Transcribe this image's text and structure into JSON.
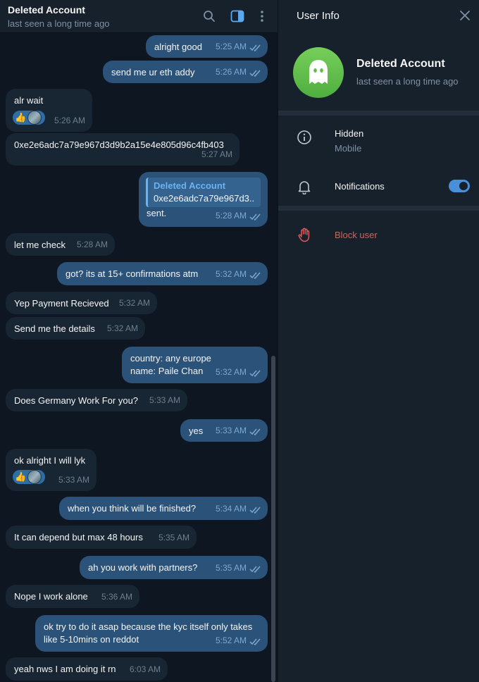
{
  "chat": {
    "title": "Deleted Account",
    "status": "last seen a long time ago",
    "messages": [
      {
        "dir": "out",
        "text": "alright good",
        "time": "5:25 AM"
      },
      {
        "dir": "out",
        "text": "send me ur eth addy",
        "time": "5:26 AM"
      },
      {
        "dir": "in",
        "text": "alr wait",
        "time": "5:26 AM",
        "reaction": "👍"
      },
      {
        "dir": "in",
        "text": "0xe2e6adc7a79e967d3d9b2a15e4e805d96c4fb403",
        "time": "5:27 AM"
      },
      {
        "dir": "out",
        "reply_name": "Deleted Account",
        "reply_text": "0xe2e6adc7a79e967d3...",
        "text": "sent.",
        "time": "5:28 AM"
      },
      {
        "dir": "in",
        "text": "let me check",
        "time": "5:28 AM"
      },
      {
        "dir": "out",
        "text": "got? its at 15+ confirmations atm",
        "time": "5:32 AM"
      },
      {
        "dir": "in",
        "text": "Yep Payment Recieved",
        "time": "5:32 AM"
      },
      {
        "dir": "in",
        "text": "Send me the details",
        "time": "5:32 AM"
      },
      {
        "dir": "out",
        "text": "country: any europe",
        "text2": "name: Paile Chan",
        "time": "5:32 AM"
      },
      {
        "dir": "in",
        "text": "Does Germany Work For you?",
        "time": "5:33 AM"
      },
      {
        "dir": "out",
        "text": "yes",
        "time": "5:33 AM"
      },
      {
        "dir": "in",
        "text": "ok alright I will lyk",
        "time": "5:33 AM",
        "reaction": "👍"
      },
      {
        "dir": "out",
        "text": "when you think will be finished?",
        "time": "5:34 AM"
      },
      {
        "dir": "in",
        "text": "It can depend but max 48 hours",
        "time": "5:35 AM"
      },
      {
        "dir": "out",
        "text": "ah you work with partners?",
        "time": "5:35 AM"
      },
      {
        "dir": "in",
        "text": "Nope I work alone",
        "time": "5:36 AM"
      },
      {
        "dir": "out",
        "text": "ok try to do it asap because the kyc itself only takes",
        "text2": "like 5-10mins on reddot",
        "time": "5:52 AM"
      },
      {
        "dir": "in",
        "text": "yeah nws I am doing it rn",
        "time": "6:03 AM"
      }
    ]
  },
  "icons": {
    "header": [
      "search-icon",
      "sidebar-toggle-icon",
      "more-vertical-icon"
    ],
    "info": [
      "close-icon",
      "ghost-icon",
      "info-icon",
      "bell-icon",
      "hand-icon"
    ]
  },
  "info": {
    "title": "User Info",
    "name": "Deleted Account",
    "status": "last seen a long time ago",
    "bio_value": "Hidden",
    "bio_label": "Mobile",
    "notifications_label": "Notifications",
    "notifications_on": true,
    "block_label": "Block user"
  },
  "colors": {
    "accent": "#6ab3f3",
    "outgoing_bubble": "#2b5278",
    "incoming_bubble": "#182533",
    "danger": "#e35a5a",
    "avatar_green": "#5cbd47"
  }
}
